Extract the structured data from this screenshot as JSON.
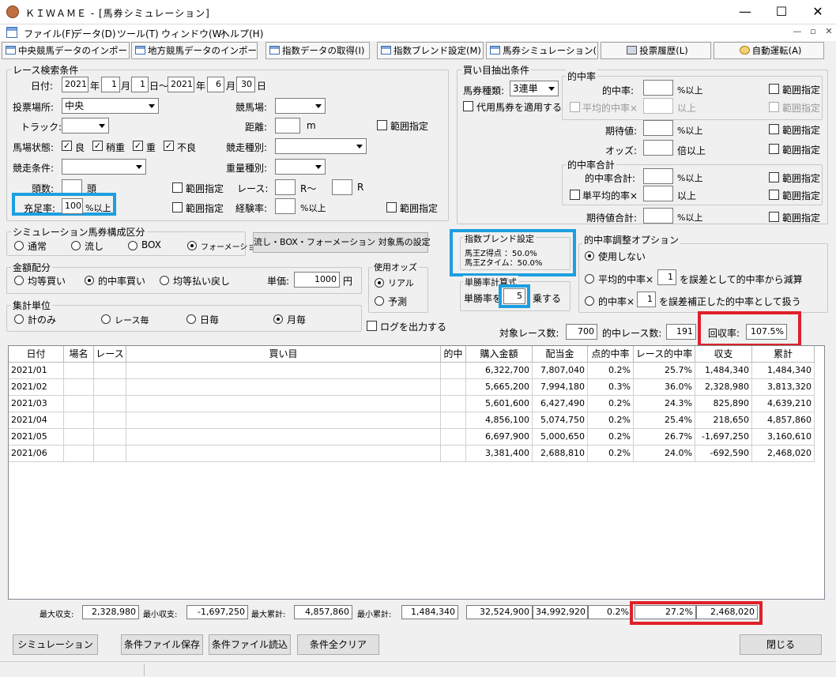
{
  "window": {
    "title": "ＫＩＷＡＭＥ - [馬券シミュレーション]",
    "minimize": "—",
    "maximize": "☐",
    "close": "✕"
  },
  "menu": [
    "ファイル(F)",
    "データ(D)",
    "ツール(T)",
    "ウィンドウ(W)",
    "ヘルプ(H)"
  ],
  "mdi": {
    "min": "—",
    "restore": "▫",
    "close": "✕"
  },
  "toolbar": [
    "中央競馬データのインポート(J)",
    "地方競馬データのインポート(N)",
    "指数データの取得(I)",
    "指数ブレンド設定(M)",
    "馬券シミュレーション(B)",
    "投票履歴(L)",
    "自動運転(A)"
  ],
  "race": {
    "title": "レース検索条件",
    "date_label": "日付:",
    "from_year": "2021",
    "year": "年",
    "from_month": "1",
    "month": "月",
    "from_day": "1",
    "day_tilde": "日～",
    "to_year": "2021",
    "to_month": "6",
    "to_day": "30",
    "day": "日",
    "place_label": "投票場所:",
    "place": "中央",
    "course_label": "競馬場:",
    "course": "",
    "track_label": "トラック:",
    "track": "",
    "distance_label": "距離:",
    "distance": "",
    "m": "m",
    "range": "範囲指定",
    "condition_label": "馬場状態:",
    "cond": [
      "良",
      "稍重",
      "重",
      "不良"
    ],
    "race_type_label": "競走種別:",
    "race_cond_label": "競走条件:",
    "weight_label": "重量種別:",
    "heads_label": "頭数:",
    "heads_unit": "頭",
    "race_label": "レース:",
    "r_from": "R～",
    "r": "R",
    "fill_label": "充足率:",
    "fill": "100",
    "fill_unit": "%以上",
    "exp_label": "経験率:",
    "exp_unit": "%以上"
  },
  "sim": {
    "title": "シミュレーション馬券構成区分",
    "options": [
      "通常",
      "流し",
      "BOX",
      "フォーメーション"
    ],
    "selected": 3,
    "setting_button": "流し・BOX・フォーメーション 対象馬の設定"
  },
  "money": {
    "title": "金額配分",
    "options": [
      "均等買い",
      "的中率買い",
      "均等払い戻し"
    ],
    "selected": 1,
    "unit_label": "単価:",
    "unit": "1000",
    "yen": "円"
  },
  "odds": {
    "title": "使用オッズ",
    "options": [
      "リアル",
      "予測"
    ],
    "selected": 0
  },
  "agg": {
    "title": "集計単位",
    "options": [
      "計のみ",
      "レース毎",
      "日毎",
      "月毎"
    ],
    "selected": 3
  },
  "log_label": "ログを出力する",
  "extract": {
    "title": "買い目抽出条件",
    "type_label": "馬券種類:",
    "type": "3連単",
    "proxy": "代用馬券を適用する",
    "hit_title": "的中率",
    "hit_label": "的中率:",
    "pct_above": "%以上",
    "range": "範囲指定",
    "avg_hit": "平均的中率×",
    "above": "以上",
    "ev_label": "期待値:",
    "odds_label": "オッズ:",
    "times_above": "倍以上",
    "sum_title": "的中率合計",
    "sum_label": "的中率合計:",
    "single_avg": "単平均的率×",
    "ev_sum_label": "期待値合計:"
  },
  "blend": {
    "title": "指数ブレンド設定",
    "line1": "馬王Z得点 ：50.0%",
    "line2": "馬王Zタイム：50.0%"
  },
  "win_calc": {
    "title": "単勝率計算式",
    "pre": "単勝率を",
    "value": "5",
    "post": "乗する"
  },
  "adjust": {
    "title": "的中率調整オプション",
    "opt1": "使用しない",
    "opt2_pre": "平均的中率×",
    "opt2_val": "1",
    "opt2_post": "を誤差として的中率から減算",
    "opt3_pre": "的中率×",
    "opt3_val": "1",
    "opt3_post": "を誤差補正した的中率として扱う"
  },
  "stats": {
    "races_label": "対象レース数:",
    "races": "700",
    "hit_races_label": "的中レース数:",
    "hit_races": "191",
    "recovery_label": "回収率:",
    "recovery": "107.5%"
  },
  "grid": {
    "headers": [
      "日付",
      "場名",
      "レース",
      "買い目",
      "的中",
      "購入金額",
      "配当金",
      "点的中率",
      "レース的中率",
      "収支",
      "累計"
    ],
    "rows": [
      [
        "2021/01",
        "",
        "",
        "",
        "",
        "6,322,700",
        "7,807,040",
        "0.2%",
        "25.7%",
        "1,484,340",
        "1,484,340"
      ],
      [
        "2021/02",
        "",
        "",
        "",
        "",
        "5,665,200",
        "7,994,180",
        "0.3%",
        "36.0%",
        "2,328,980",
        "3,813,320"
      ],
      [
        "2021/03",
        "",
        "",
        "",
        "",
        "5,601,600",
        "6,427,490",
        "0.2%",
        "24.3%",
        "825,890",
        "4,639,210"
      ],
      [
        "2021/04",
        "",
        "",
        "",
        "",
        "4,856,100",
        "5,074,750",
        "0.2%",
        "25.4%",
        "218,650",
        "4,857,860"
      ],
      [
        "2021/05",
        "",
        "",
        "",
        "",
        "6,697,900",
        "5,000,650",
        "0.2%",
        "26.7%",
        "-1,697,250",
        "3,160,610"
      ],
      [
        "2021/06",
        "",
        "",
        "",
        "",
        "3,381,400",
        "2,688,810",
        "0.2%",
        "24.0%",
        "-692,590",
        "2,468,020"
      ]
    ]
  },
  "summary": {
    "max_income_label": "最大収支:",
    "max_income": "2,328,980",
    "min_income_label": "最小収支:",
    "min_income": "-1,697,250",
    "max_total_label": "最大累計:",
    "max_total": "4,857,860",
    "min_total_label": "最小累計:",
    "min_total": "1,484,340",
    "purchase": "32,524,900",
    "payout": "34,992,920",
    "point_hit": "0.2%",
    "race_hit": "27.2%",
    "total": "2,468,020"
  },
  "buttons": {
    "simulate": "シミュレーション",
    "save": "条件ファイル保存",
    "load": "条件ファイル読込",
    "clear": "条件全クリア",
    "close": "閉じる"
  }
}
